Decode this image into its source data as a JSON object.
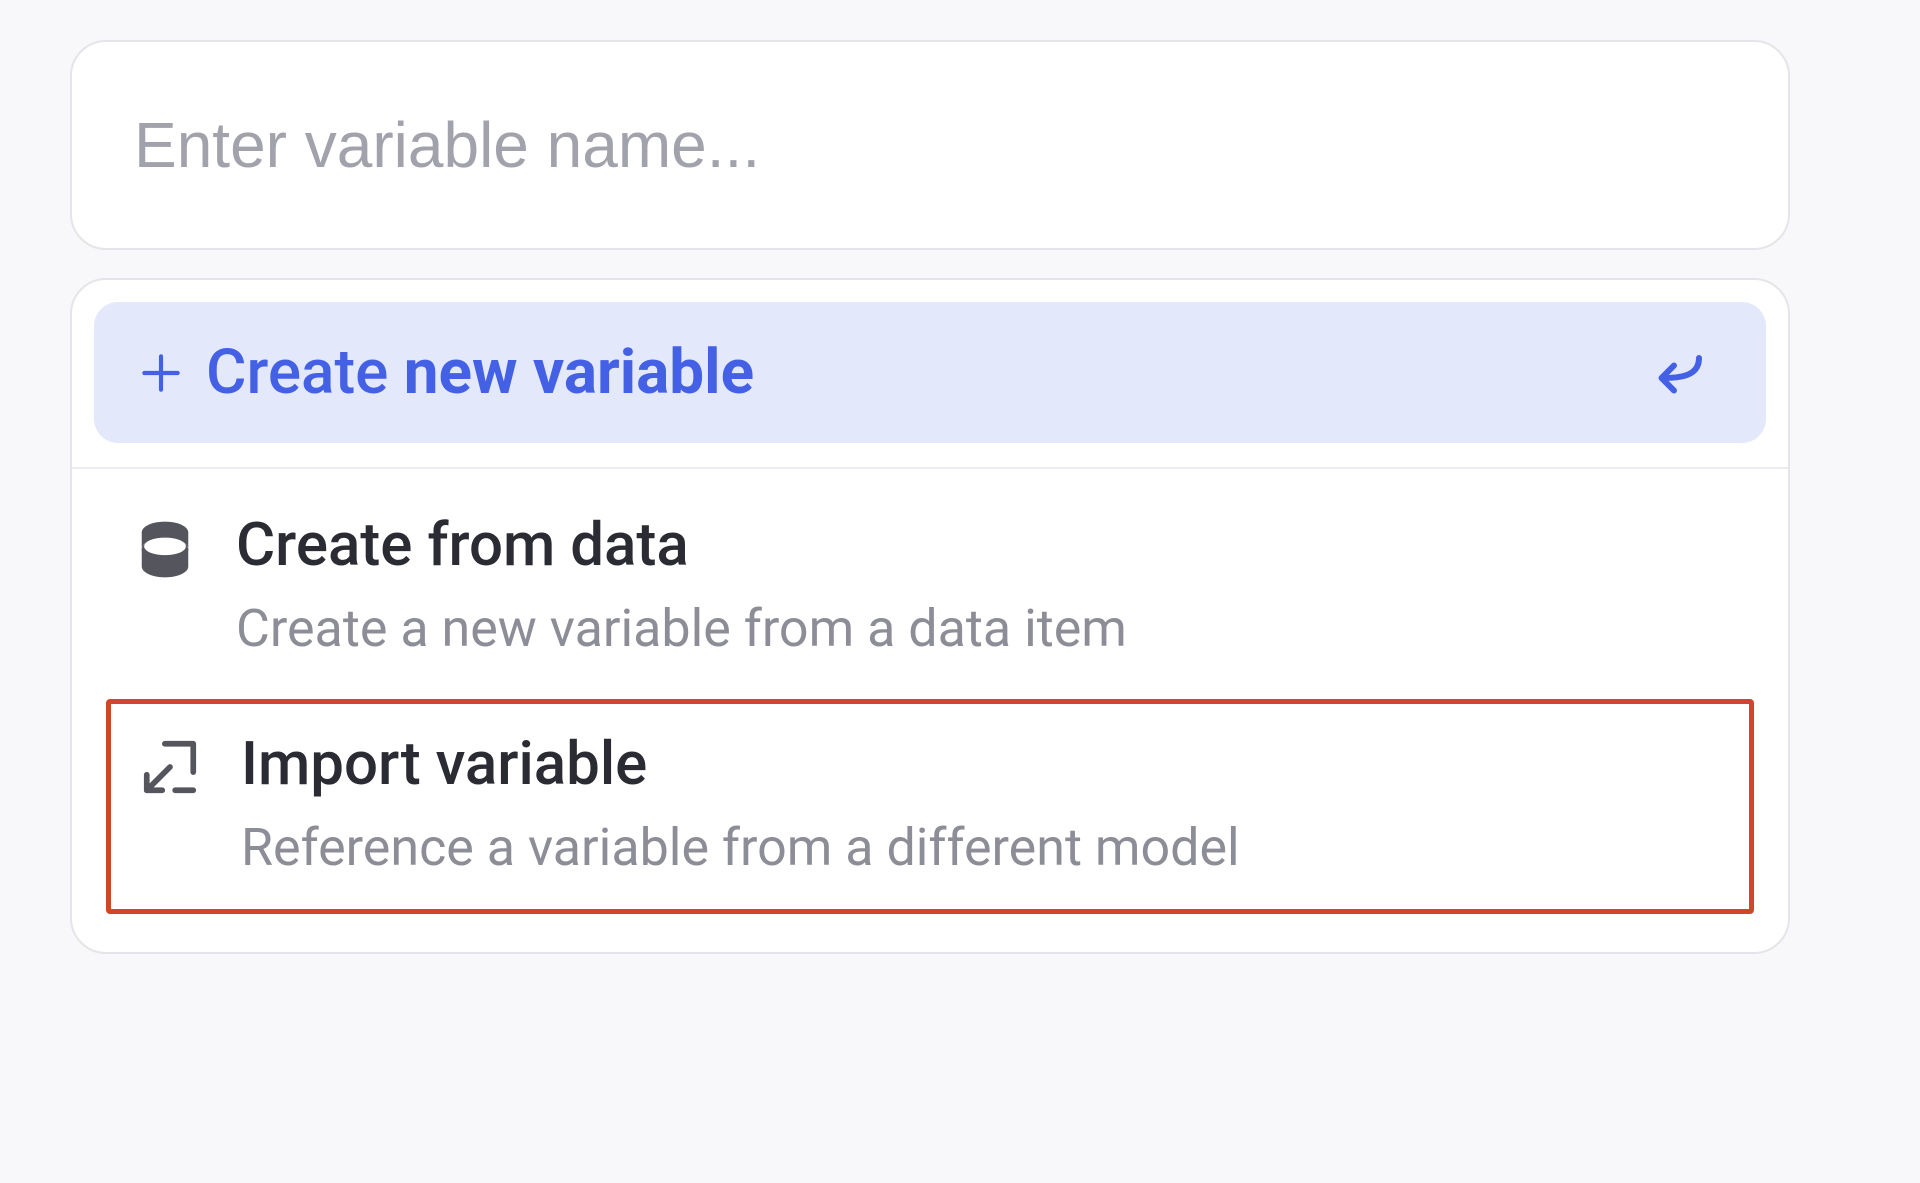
{
  "input": {
    "placeholder": "Enter variable name...",
    "value": ""
  },
  "options": {
    "create_new": {
      "prefix": "Create ",
      "bold_part": "new variable"
    },
    "from_data": {
      "title": "Create from data",
      "subtitle": "Create a new variable from a data item"
    },
    "import": {
      "title": "Import variable",
      "subtitle": "Reference a variable from a different model"
    }
  },
  "colors": {
    "accent": "#4461e6",
    "highlight_border": "#d1452a"
  }
}
